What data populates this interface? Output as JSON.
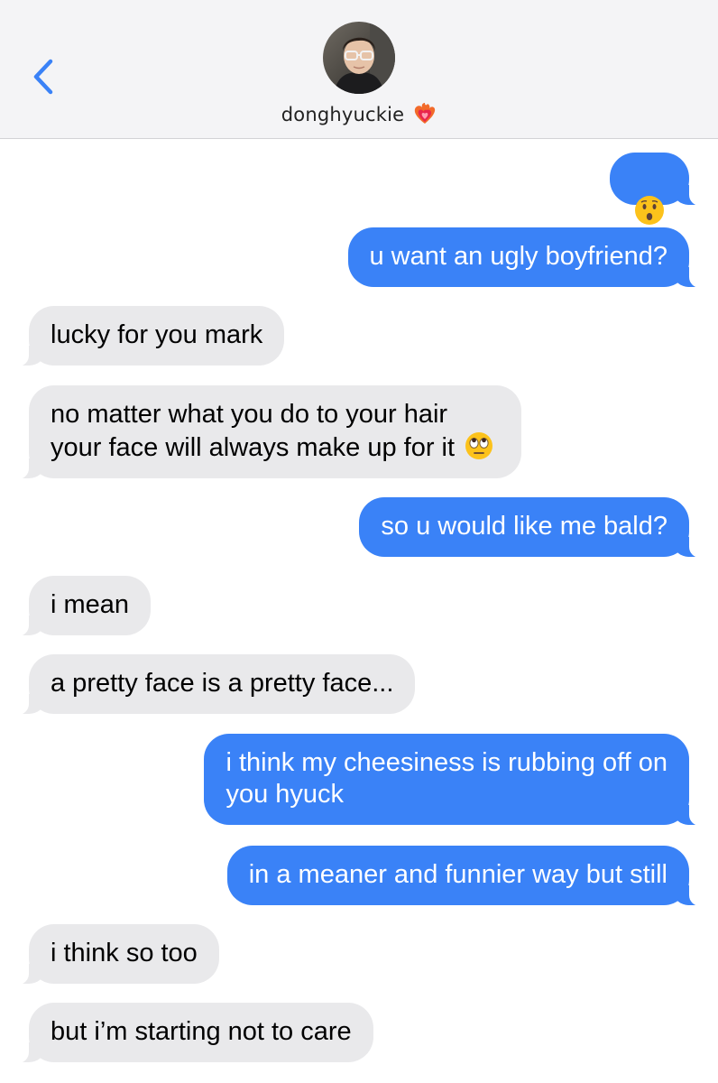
{
  "header": {
    "contact_name": "donghyuckie",
    "back_icon": "chevron-left-icon",
    "status_emoji": "heart-on-fire-emoji",
    "accent_color": "#3a82f7"
  },
  "messages": [
    {
      "side": "out",
      "text": "😯"
    },
    {
      "side": "out",
      "text": "u want an ugly boyfriend?"
    },
    {
      "side": "in",
      "text": "lucky for you mark"
    },
    {
      "side": "in",
      "text": "no matter what you do to your hair\nyour face will always make up for it",
      "emoji": "face-with-rolling-eyes"
    },
    {
      "side": "out",
      "text": "so u would like me bald?"
    },
    {
      "side": "in",
      "text": "i mean"
    },
    {
      "side": "in",
      "text": "a pretty face is a pretty face..."
    },
    {
      "side": "out",
      "text": "i think my cheesiness is rubbing off on\nyou hyuck"
    },
    {
      "side": "out",
      "text": "in a meaner and funnier way but still"
    },
    {
      "side": "in",
      "text": "i think so too"
    },
    {
      "side": "in",
      "text": "but i’m starting not to care"
    }
  ]
}
